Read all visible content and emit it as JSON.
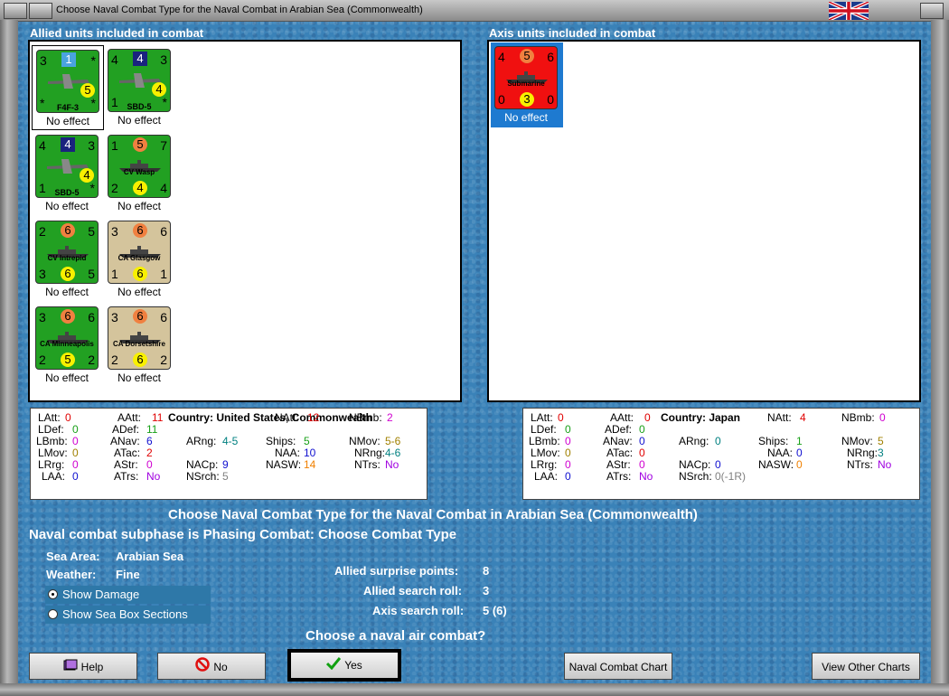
{
  "window": {
    "title": "Choose Naval Combat Type for the Naval Combat in Arabian Sea (Commonwealth)"
  },
  "allied": {
    "heading": "Allied units included in combat",
    "units": [
      {
        "name": "F4F-3",
        "tl": "3",
        "tr": "*",
        "top": "1",
        "ml": "*",
        "bot": "5",
        "bl": "*",
        "br": "*",
        "effect": "No effect",
        "bg": "#22a022",
        "topType": "sq lb",
        "botType": "ci y"
      },
      {
        "name": "SBD-5",
        "tl": "4",
        "tr": "3",
        "top": "4",
        "bot": "4",
        "bl": "1",
        "br": "*",
        "effect": "No effect",
        "bg": "#22a022",
        "topType": "sq",
        "botType": "ci y"
      },
      {
        "name": "SBD-5",
        "tl": "4",
        "tr": "3",
        "top": "4",
        "bot": "4",
        "bl": "1",
        "br": "*",
        "effect": "No effect",
        "bg": "#22a022",
        "topType": "sq",
        "botType": "ci y"
      },
      {
        "name": "CV Wasp",
        "tl": "1",
        "tr": "7",
        "top": "5",
        "bot": "4",
        "bl": "2",
        "br": "4",
        "effect": "No effect",
        "bg": "#22a022",
        "topType": "ci o",
        "botType": "ci y"
      },
      {
        "name": "CV Intrepid",
        "tl": "2",
        "tr": "5",
        "top": "6",
        "bot": "6",
        "bl": "3",
        "br": "5",
        "effect": "No effect",
        "bg": "#22a022",
        "topType": "ci o",
        "botType": "ci y"
      },
      {
        "name": "CA Glasgow",
        "tl": "3",
        "tr": "6",
        "top": "6",
        "bot": "6",
        "bl": "1",
        "br": "1",
        "effect": "No effect",
        "bg": "#d4c49c",
        "topType": "ci o",
        "botType": "ci y"
      },
      {
        "name": "CA Minneapolis",
        "tl": "3",
        "tr": "6",
        "top": "6",
        "bot": "5",
        "bl": "2",
        "br": "2",
        "effect": "No effect",
        "bg": "#22a022",
        "topType": "ci o",
        "botType": "ci y"
      },
      {
        "name": "CA Dorsetshire",
        "tl": "3",
        "tr": "6",
        "top": "6",
        "bot": "6",
        "bl": "2",
        "br": "2",
        "effect": "No effect",
        "bg": "#d4c49c",
        "topType": "ci o",
        "botType": "ci y"
      }
    ],
    "stats": {
      "country": "Country: United States, Commonwealth",
      "latt": "0",
      "aatt": "11",
      "natt": "12",
      "nbmb": "2",
      "ldef": "0",
      "adef": "11",
      "lbmb": "0",
      "anav": "6",
      "arng": "4-5",
      "ships": "5",
      "nmov": "5-6",
      "lmov": "0",
      "atac": "2",
      "naa": "10",
      "nrng": "4-6",
      "lrrg": "0",
      "astr": "0",
      "nacp": "9",
      "nasw": "14",
      "ntrs": "No",
      "laa": "0",
      "atrs": "No",
      "nsrch": "5"
    }
  },
  "axis": {
    "heading": "Axis units included in combat",
    "units": [
      {
        "name": "Submarine",
        "tl": "4",
        "tr": "6",
        "top": "5",
        "bot": "3",
        "bl": "0",
        "br": "0",
        "effect": "No effect",
        "bg": "#f01010",
        "topType": "ci o",
        "botType": "ci y"
      }
    ],
    "stats": {
      "country": "Country: Japan",
      "latt": "0",
      "aatt": "0",
      "natt": "4",
      "nbmb": "0",
      "ldef": "0",
      "adef": "0",
      "lbmb": "0",
      "anav": "0",
      "arng": "0",
      "ships": "1",
      "nmov": "5",
      "lmov": "0",
      "atac": "0",
      "naa": "0",
      "nrng": "3",
      "lrrg": "0",
      "astr": "0",
      "nacp": "0",
      "nasw": "0",
      "ntrs": "No",
      "laa": "0",
      "atrs": "No",
      "nsrch": "0(-1R)"
    }
  },
  "labels": {
    "latt": "LAtt:",
    "aatt": "AAtt:",
    "natt": "NAtt:",
    "nbmb": "NBmb:",
    "ldef": "LDef:",
    "adef": "ADef:",
    "lbmb": "LBmb:",
    "anav": "ANav:",
    "arng": "ARng:",
    "ships": "Ships:",
    "nmov": "NMov:",
    "lmov": "LMov:",
    "atac": "ATac:",
    "naa": "NAA:",
    "nrng": "NRng:",
    "lrrg": "LRrg:",
    "astr": "AStr:",
    "nacp": "NACp:",
    "nasw": "NASW:",
    "ntrs": "NTrs:",
    "laa": "LAA:",
    "atrs": "ATrs:",
    "nsrch": "NSrch:"
  },
  "info": {
    "heading": "Choose Naval Combat Type for the Naval Combat in Arabian Sea (Commonwealth)",
    "subphase": "Naval combat subphase is Phasing Combat: Choose Combat Type",
    "sea_area_label": "Sea Area:",
    "sea_area": "Arabian Sea",
    "weather_label": "Weather:",
    "weather": "Fine",
    "show_damage": "Show Damage",
    "show_sea_box": "Show Sea Box Sections",
    "surprise_label": "Allied surprise points:",
    "surprise": "8",
    "allied_search_label": "Allied search roll:",
    "allied_search": "3",
    "axis_search_label": "Axis search roll:",
    "axis_search": "5 (6)",
    "question": "Choose a naval air combat?"
  },
  "buttons": {
    "help": "Help",
    "no": "No",
    "yes": "Yes",
    "naval_chart": "Naval Combat Chart",
    "other_charts": "View Other Charts"
  }
}
